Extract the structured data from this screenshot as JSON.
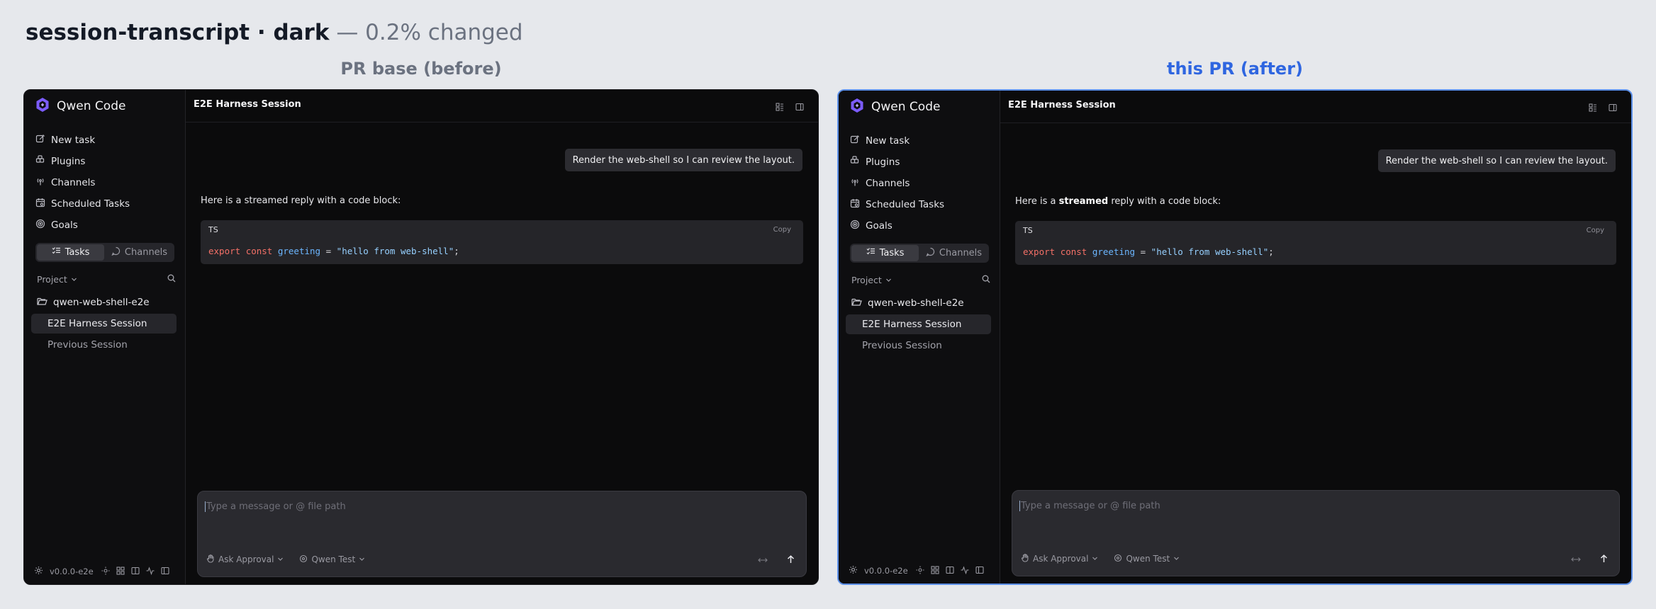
{
  "heading": {
    "title": "session-transcript · dark",
    "subtitle": "— 0.2% changed"
  },
  "columns": {
    "before_label": "PR base (before)",
    "after_label": "this PR (after)"
  },
  "app": {
    "brand": "Qwen Code",
    "nav": {
      "new_task": "New task",
      "plugins": "Plugins",
      "channels": "Channels",
      "scheduled": "Scheduled Tasks",
      "goals": "Goals"
    },
    "segment": {
      "tasks": "Tasks",
      "channels": "Channels"
    },
    "project_label": "Project",
    "folder": "qwen-web-shell-e2e",
    "sessions": {
      "active": "E2E Harness Session",
      "previous": "Previous Session"
    },
    "version": "v0.0.0-e2e",
    "session_title": "E2E Harness Session",
    "user_message": "Render the web-shell so I can review the layout.",
    "reply": {
      "plain": "Here is a streamed reply with a code block:",
      "prefix": "Here is a ",
      "bold": "streamed",
      "suffix": " reply with a code block:"
    },
    "code": {
      "lang": "TS",
      "copy": "Copy",
      "kw_export": "export",
      "kw_const": "const",
      "ident": "greeting",
      "op": "=",
      "str": "\"hello from web-shell\"",
      "end": ";"
    },
    "composer": {
      "placeholder": "Type a message or @ file path",
      "approval": "Ask Approval",
      "model": "Qwen Test"
    }
  },
  "colors": {
    "accent": "#2f66e0",
    "logo": "#7c5cff",
    "keyword": "#f47067",
    "identifier": "#6cb6ff",
    "string": "#96d0ff"
  }
}
